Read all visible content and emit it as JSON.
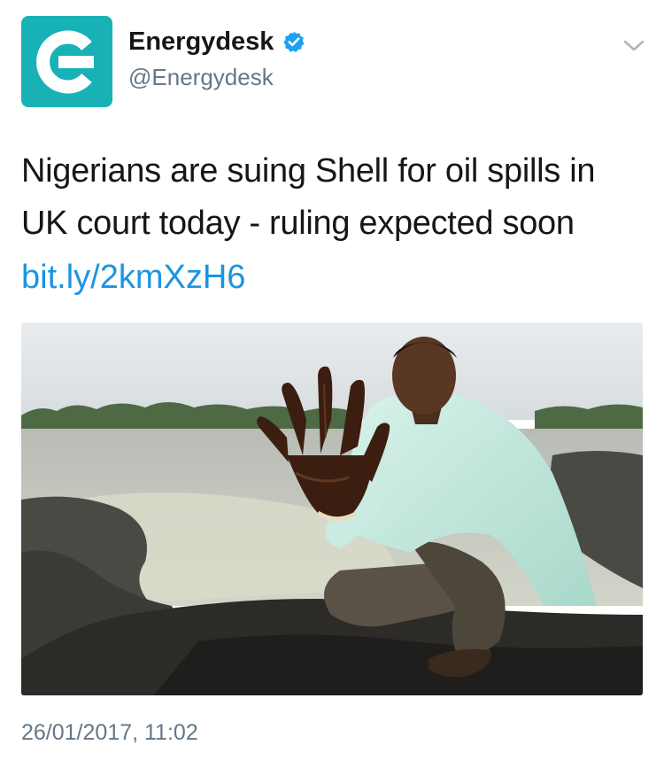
{
  "author": {
    "display_name": "Energydesk",
    "handle": "@Energydesk",
    "verified": true,
    "avatar_icon": "energydesk-logo-icon",
    "avatar_color": "#18b2b6"
  },
  "tweet": {
    "text": "Nigerians are suing Shell for oil spills in UK court today - ruling expected soon",
    "link": "bit.ly/2kmXzH6",
    "timestamp": "26/01/2017, 11:02"
  },
  "menu": {
    "icon": "chevron-down-icon"
  },
  "colors": {
    "link": "#1b95e0",
    "secondary_text": "#657786",
    "verified_badge": "#1da1f2"
  }
}
